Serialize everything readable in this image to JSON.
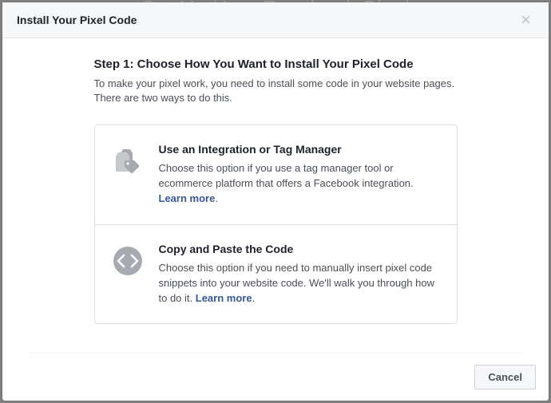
{
  "backdrop_title": "Set Up Your Facebook Pixel",
  "modal": {
    "title": "Install Your Pixel Code",
    "close_glyph": "×"
  },
  "step": {
    "heading": "Step 1: Choose How You Want to Install Your Pixel Code",
    "description": "To make your pixel work, you need to install some code in your website pages. There are two ways to do this."
  },
  "options": [
    {
      "title": "Use an Integration or Tag Manager",
      "desc": "Choose this option if you use a tag manager tool or ecommerce platform that offers a Facebook integration. ",
      "learn_more": "Learn more"
    },
    {
      "title": "Copy and Paste the Code",
      "desc": "Choose this option if you need to manually insert pixel code snippets into your website code. We'll walk you through how to do it. ",
      "learn_more": "Learn more"
    }
  ],
  "footer": {
    "cancel": "Cancel"
  }
}
